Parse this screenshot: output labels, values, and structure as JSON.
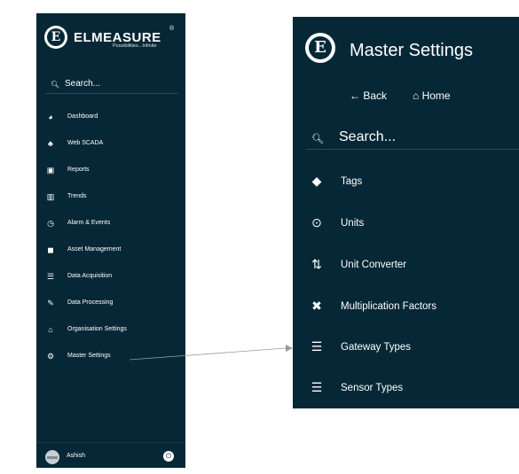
{
  "colors": {
    "panel_bg": "#062836",
    "text": "#ffffff",
    "connector": "#9a9a9a"
  },
  "left_sidebar": {
    "brand": {
      "name": "ELMEASURE",
      "registered": "®",
      "tagline": "Possibilities...Infinite",
      "logo_letter": "E"
    },
    "search": {
      "icon": "search-icon",
      "label": "Search..."
    },
    "items": [
      {
        "icon": "pie-chart-icon",
        "glyph": "◕",
        "label": "Dashboard"
      },
      {
        "icon": "sitemap-icon",
        "glyph": "♣",
        "label": "Web SCADA"
      },
      {
        "icon": "file-excel-icon",
        "glyph": "▣",
        "label": "Reports"
      },
      {
        "icon": "bar-chart-icon",
        "glyph": "▥",
        "label": "Trends"
      },
      {
        "icon": "clock-icon",
        "glyph": "◷",
        "label": "Alarm & Events"
      },
      {
        "icon": "asset-icon",
        "glyph": "◼",
        "label": "Asset Management"
      },
      {
        "icon": "database-icon",
        "glyph": "☰",
        "label": "Data Acquisition"
      },
      {
        "icon": "wrench-icon",
        "glyph": "✎",
        "label": "Data Processing"
      },
      {
        "icon": "bank-icon",
        "glyph": "⌂",
        "label": "Organisation Settings"
      },
      {
        "icon": "cogs-icon",
        "glyph": "⚙",
        "label": "Master Settings"
      }
    ],
    "footer": {
      "user_name": "Ashish",
      "power_glyph": "⏻"
    }
  },
  "right_panel": {
    "logo_letter": "E",
    "title": "Master Settings",
    "back": {
      "glyph": "←",
      "label": "Back"
    },
    "home": {
      "glyph": "⌂",
      "label": "Home"
    },
    "search": {
      "icon": "search-icon",
      "label": "Search..."
    },
    "items": [
      {
        "icon": "tag-icon",
        "glyph": "◆",
        "label": "Tags"
      },
      {
        "icon": "dot-circle-icon",
        "glyph": "⊙",
        "label": "Units"
      },
      {
        "icon": "sort-numeric-icon",
        "glyph": "⇅",
        "label": "Unit Converter"
      },
      {
        "icon": "times-icon",
        "glyph": "✖",
        "label": "Multiplication Factors"
      },
      {
        "icon": "list-icon",
        "glyph": "☰",
        "label": "Gateway Types"
      },
      {
        "icon": "list-icon",
        "glyph": "☰",
        "label": "Sensor Types"
      }
    ]
  }
}
